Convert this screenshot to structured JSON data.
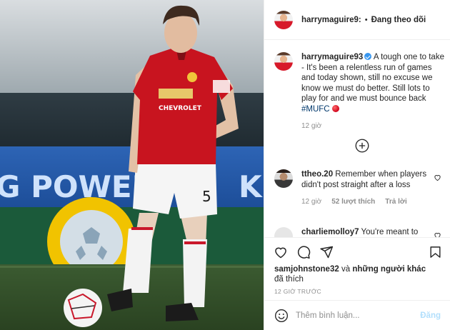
{
  "post": {
    "image_alt": "",
    "ad_board_text": "G POWEF",
    "ad_board_tail": "K",
    "shirt_sponsor": "CHEVROLET",
    "shirt_number": "5"
  },
  "header": {
    "username": "harrymaguire9:",
    "separator": "•",
    "follow_label": "Đang theo dõi"
  },
  "caption": {
    "username": "harrymaguire93",
    "text": "A tough one to take - It's been a relentless run of games and today shown, still no excuse we know we must do better. Still lots to play for and we must bounce back",
    "hashtag": "#MUFC",
    "time": "12 giờ"
  },
  "comments": [
    {
      "username": "ttheo.20",
      "text": "Remember when players didn't post straight after a loss",
      "time": "12 giờ",
      "likes": "52 lượt thích",
      "reply": "Trả lời"
    },
    {
      "username": "charliemolloy7",
      "text": "You're meant to"
    }
  ],
  "likes": {
    "first_user": "samjohnstone32",
    "connector": "và",
    "others": "những người khác",
    "suffix": "đã thích"
  },
  "timestamp": "12 GIỜ TRƯỚC",
  "add_comment": {
    "placeholder": "Thêm bình luận...",
    "post_label": "Đăng"
  },
  "colors": {
    "link": "#00376b",
    "verified": "#3897f0",
    "muted": "#8e8e8e",
    "post_disabled": "#b2dffc"
  }
}
